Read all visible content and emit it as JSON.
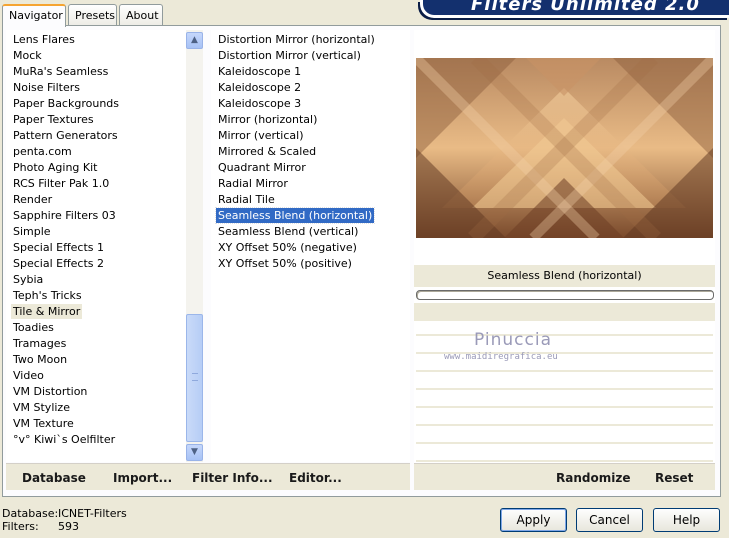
{
  "tabs": {
    "navigator": "Navigator",
    "presets": "Presets",
    "about": "About"
  },
  "banner": {
    "title": "Filters Unlimited 2.0"
  },
  "categories": [
    "Lens Flares",
    "Mock",
    "MuRa's Seamless",
    "Noise Filters",
    "Paper Backgrounds",
    "Paper Textures",
    "Pattern Generators",
    "penta.com",
    "Photo Aging Kit",
    "RCS Filter Pak 1.0",
    "Render",
    "Sapphire Filters 03",
    "Simple",
    "Special Effects 1",
    "Special Effects 2",
    "Sybia",
    "Teph's Tricks",
    "Tile & Mirror",
    "Toadies",
    "Tramages",
    "Two Moon",
    "Video",
    "VM Distortion",
    "VM Stylize",
    "VM Texture",
    "°v° Kiwi`s Oelfilter"
  ],
  "selected_category": "Tile & Mirror",
  "filters": [
    "Distortion Mirror (horizontal)",
    "Distortion Mirror (vertical)",
    "Kaleidoscope 1",
    "Kaleidoscope 2",
    "Kaleidoscope 3",
    "Mirror (horizontal)",
    "Mirror (vertical)",
    "Mirrored & Scaled",
    "Quadrant Mirror",
    "Radial Mirror",
    "Radial Tile",
    "Seamless Blend (horizontal)",
    "Seamless Blend (vertical)",
    "XY Offset 50% (negative)",
    "XY Offset 50% (positive)"
  ],
  "selected_filter": "Seamless Blend (horizontal)",
  "preview": {
    "filter_name": "Seamless Blend (horizontal)"
  },
  "watermark": {
    "name": "Pinuccia",
    "url": "www.maidiregrafica.eu"
  },
  "left_buttons": {
    "database": "Database",
    "import": "Import...",
    "filter_info": "Filter Info...",
    "editor": "Editor..."
  },
  "right_buttons": {
    "randomize": "Randomize",
    "reset": "Reset"
  },
  "footer": {
    "database_label": "Database:",
    "database_value": "ICNET-Filters",
    "filters_label": "Filters:",
    "filters_value": "593"
  },
  "dialog_buttons": {
    "apply": "Apply",
    "cancel": "Cancel",
    "help": "Help"
  },
  "colors": {
    "selection": "#316ac5",
    "banner": "#13306e",
    "preview_light": "#f0c590",
    "preview_dark": "#6e4227"
  }
}
